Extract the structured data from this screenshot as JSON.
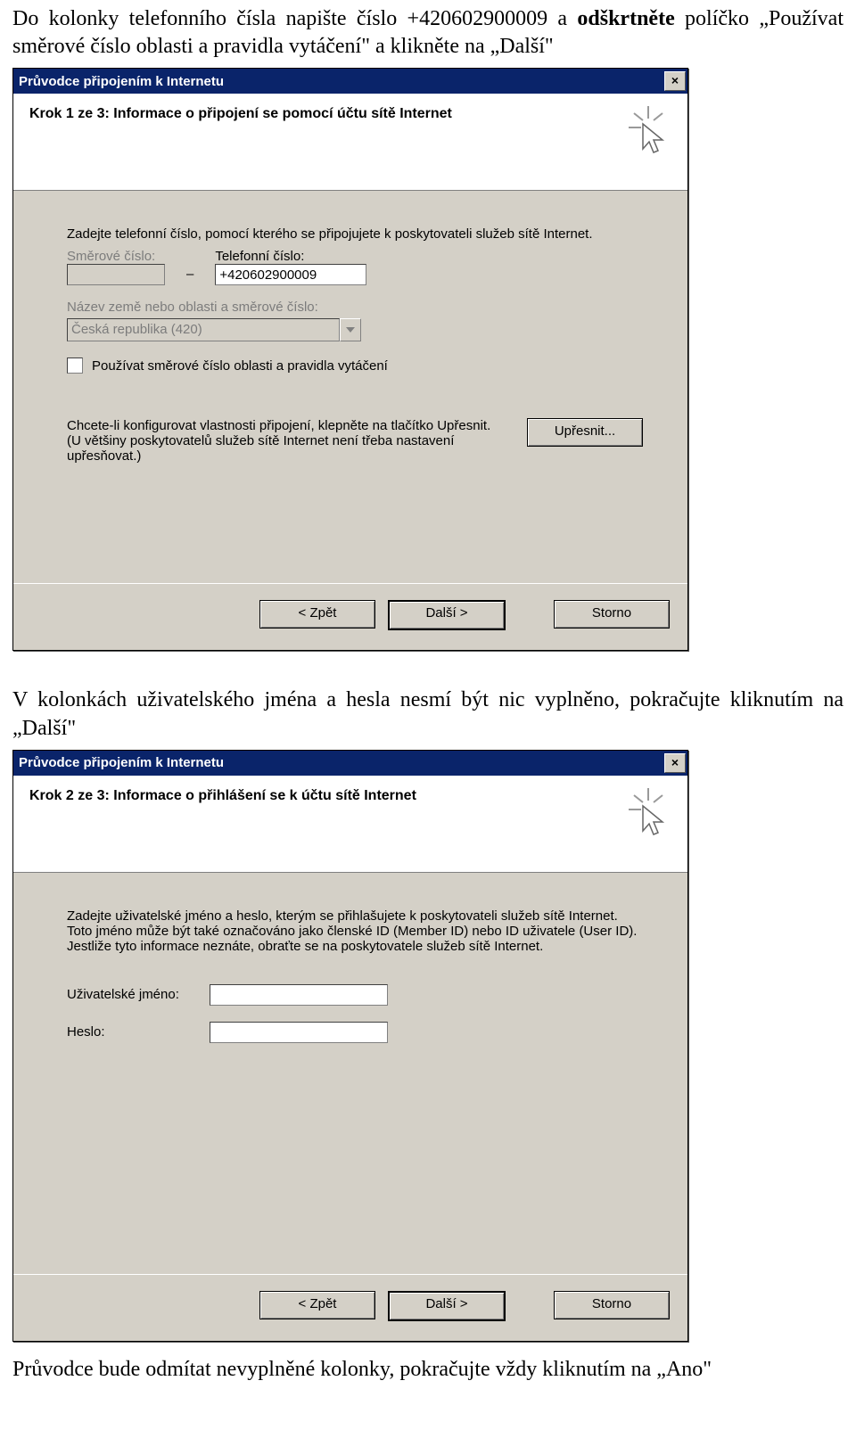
{
  "intro1_a": "Do kolonky telefonního čísla napište číslo  +420602900009 a ",
  "intro1_b": "odškrtněte",
  "intro1_c": " políčko „Používat směrové číslo oblasti a pravidla vytáčení\" a klikněte na „Další\"",
  "intro2": "V kolonkách uživatelského jména a hesla nesmí být nic vyplněno, pokračujte kliknutím na „Další\"",
  "intro3": "Průvodce bude odmítat nevyplněné kolonky, pokračujte vždy kliknutím na „Ano\"",
  "dialog1": {
    "title": "Průvodce připojením k Internetu",
    "step_title": "Krok 1 ze 3: Informace o připojení se pomocí účtu sítě Internet",
    "intro": "Zadejte telefonní číslo, pomocí kterého se připojujete k poskytovateli služeb sítě Internet.",
    "area_label": "Směrové číslo:",
    "phone_label": "Telefonní číslo:",
    "phone_value": "+420602900009",
    "country_label": "Název země nebo oblasti a směrové číslo:",
    "country_value": "Česká republika (420)",
    "checkbox_label": "Používat směrové číslo oblasti a pravidla vytáčení",
    "config_text1": "Chcete-li konfigurovat vlastnosti připojení, klepněte na tlačítko Upřesnit.",
    "config_text2": "(U většiny poskytovatelů služeb sítě Internet není třeba nastavení upřesňovat.)",
    "btn_adv": "Upřesnit...",
    "btn_back": "< Zpět",
    "btn_next": "Další >",
    "btn_cancel": "Storno"
  },
  "dialog2": {
    "title": "Průvodce připojením k Internetu",
    "step_title": "Krok 2 ze 3: Informace o přihlášení se k účtu sítě Internet",
    "intro": "Zadejte uživatelské jméno a heslo, kterým se přihlašujete k poskytovateli služeb sítě Internet. Toto jméno může být také označováno jako členské ID (Member ID) nebo ID uživatele (User ID). Jestliže tyto informace neznáte, obraťte se na poskytovatele služeb sítě Internet.",
    "user_label": "Uživatelské jméno:",
    "pass_label": "Heslo:",
    "btn_back": "< Zpět",
    "btn_next": "Další >",
    "btn_cancel": "Storno"
  }
}
